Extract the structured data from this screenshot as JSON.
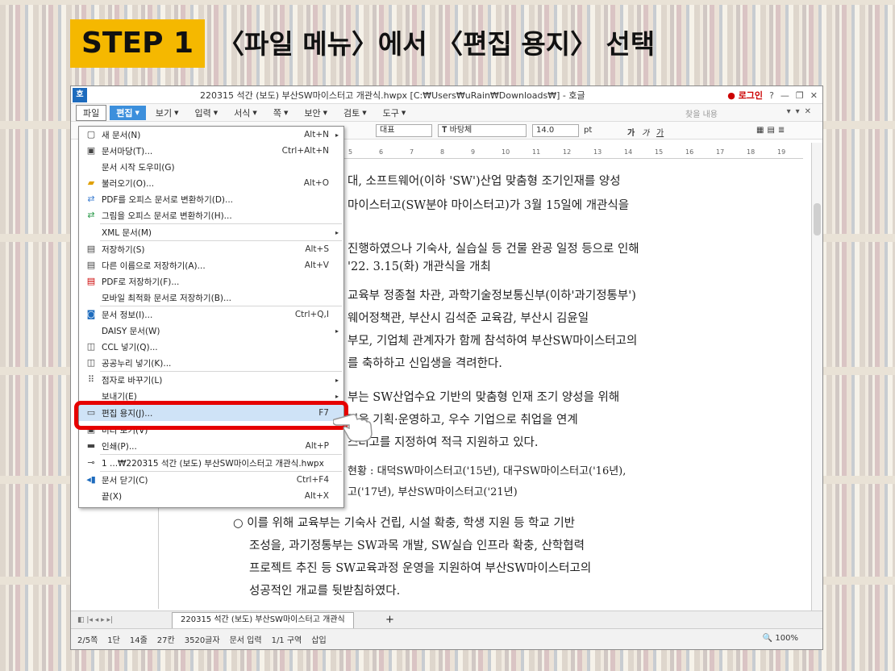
{
  "step": {
    "label": "STEP 1",
    "description": "〈파일 메뉴〉에서 〈편집 용지〉 선택"
  },
  "window": {
    "title": "220315 석간 (보도) 부산SW마이스터고 개관식.hwpx [C:₩Users₩uRain₩Downloads₩] - 호글",
    "login_label": "로그인",
    "help": "?",
    "app_icon": "호"
  },
  "menubar": {
    "items": [
      "파일",
      "편집",
      "보기",
      "입력",
      "서식",
      "쪽",
      "보안",
      "검토",
      "도구"
    ],
    "find_placeholder": "찾을 내용"
  },
  "toolbar": {
    "style": "대표",
    "font": "바탕체",
    "size": "14.0",
    "unit": "pt",
    "bold": "가",
    "italic": "가",
    "underline": "가"
  },
  "ruler": [
    "5",
    "6",
    "7",
    "8",
    "9",
    "10",
    "11",
    "12",
    "13",
    "14",
    "15",
    "16",
    "17",
    "18",
    "19"
  ],
  "document": {
    "lines": [
      "대, 소프트웨어(이하 'SW')산업 맞춤형 조기인재를 양성",
      "마이스터고(SW분야 마이스터고)가 3월 15일에 개관식을",
      "진행하였으나 기숙사, 실습실 등 건물 완공 일정 등으로 인해",
      "'22. 3.15(화) 개관식을 개최",
      "교육부 정종철 차관, 과학기술정보통신부(이하'과기정통부')",
      "웨어정책관, 부산시 김석준 교육감, 부산시 김윤일",
      "부모, 기업체 관계자가 함께 참석하여 부산SW마이스터고의",
      "를 축하하고 신입생을 격려한다.",
      "부는 SW산업수요 기반의 맞춤형 인재 조기 양성을 위해",
      "정을 기획·운영하고, 우수 기업으로 취업을 연계",
      "스터고를 지정하여 적극 지원하고 있다.",
      "현황 : 대덕SW마이스터고('15년), 대구SW마이스터고('16년),",
      "고('17년), 부산SW마이스터고('21년)",
      "○ 이를 위해 교육부는 기숙사 건립, 시설 확충, 학생 지원 등 학교 기반",
      "조성을, 과기정통부는 SW과목 개발, SW실습 인프라 확충, 산학협력",
      "프로젝트 추진 등 SW교육과정 운영을 지원하여 부산SW마이스터고의",
      "성공적인 개교를 뒷받침하였다."
    ]
  },
  "file_menu": [
    {
      "label": "새 문서(N)",
      "shortcut": "Alt+N",
      "icon": "page-icon",
      "sub": true
    },
    {
      "label": "문서마당(T)...",
      "shortcut": "Ctrl+Alt+N",
      "icon": "template-icon"
    },
    {
      "label": "문서 시작 도우미(G)",
      "shortcut": "",
      "icon": ""
    },
    {
      "label": "불러오기(O)...",
      "shortcut": "Alt+O",
      "icon": "folder-icon"
    },
    {
      "label": "PDF를 오피스 문서로 변환하기(D)...",
      "shortcut": "",
      "icon": "convert-icon"
    },
    {
      "label": "그림을 오피스 문서로 변환하기(H)...",
      "shortcut": "",
      "icon": "image-convert-icon"
    },
    {
      "label": "XML 문서(M)",
      "shortcut": "",
      "icon": "",
      "sub": true
    },
    {
      "label": "저장하기(S)",
      "shortcut": "Alt+S",
      "icon": "save-icon"
    },
    {
      "label": "다른 이름으로 저장하기(A)...",
      "shortcut": "Alt+V",
      "icon": "save-as-icon"
    },
    {
      "label": "PDF로 저장하기(F)...",
      "shortcut": "",
      "icon": "pdf-icon"
    },
    {
      "label": "모바일 최적화 문서로 저장하기(B)...",
      "shortcut": "",
      "icon": ""
    },
    {
      "label": "문서 정보(I)...",
      "shortcut": "Ctrl+Q,I",
      "icon": "info-icon"
    },
    {
      "label": "DAISY 문서(W)",
      "shortcut": "",
      "icon": "",
      "sub": true
    },
    {
      "label": "CCL 넣기(Q)...",
      "shortcut": "",
      "icon": "ccl-icon"
    },
    {
      "label": "공공누리 넣기(K)...",
      "shortcut": "",
      "icon": "kogl-icon"
    },
    {
      "label": "점자로 바꾸기(L)",
      "shortcut": "",
      "icon": "braille-icon",
      "sub": true
    },
    {
      "label": "보내기(E)",
      "shortcut": "",
      "icon": "",
      "sub": true
    },
    {
      "label": "편집 용지(J)...",
      "shortcut": "F7",
      "icon": "page-setup-icon",
      "selected": true
    },
    {
      "label": "미리 보기(V)",
      "shortcut": "",
      "icon": "preview-icon"
    },
    {
      "label": "인쇄(P)...",
      "shortcut": "Alt+P",
      "icon": "print-icon"
    },
    {
      "label": "1 ...₩220315 석간 (보도) 부산SW마이스터고 개관식.hwpx",
      "shortcut": "",
      "icon": "recent-icon"
    },
    {
      "label": "문서 닫기(C)",
      "shortcut": "Ctrl+F4",
      "icon": "close-doc-icon"
    },
    {
      "label": "끝(X)",
      "shortcut": "Alt+X",
      "icon": ""
    }
  ],
  "tabs": {
    "document_tab": "220315 석간 (보도) 부산SW마이스터고 개관식",
    "add": "+"
  },
  "status": {
    "page": "2/5쪽",
    "section": "1단",
    "line": "14줄",
    "col": "27칸",
    "chars": "3520글자",
    "mode": "문서 입력",
    "area": "1/1 구역",
    "insert": "삽입",
    "zoom": "100%"
  },
  "colors": {
    "step_bg": "#f5b800",
    "highlight": "#e60000",
    "edit_tab": "#3c8fdc"
  }
}
